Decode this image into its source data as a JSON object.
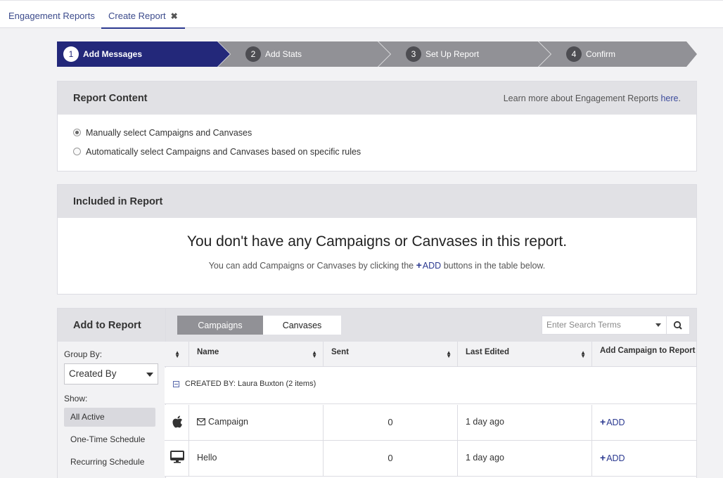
{
  "tabs": [
    {
      "label": "Engagement Reports"
    },
    {
      "label": "Create Report",
      "close": "✖"
    }
  ],
  "wizard": {
    "steps": [
      {
        "num": "1",
        "label": "Add Messages"
      },
      {
        "num": "2",
        "label": "Add Stats"
      },
      {
        "num": "3",
        "label": "Set Up Report"
      },
      {
        "num": "4",
        "label": "Confirm"
      }
    ],
    "active_step": 1
  },
  "report_content": {
    "title": "Report Content",
    "learn_prefix": "Learn more about Engagement Reports",
    "learn_link": "here",
    "learn_suffix": ".",
    "options": [
      {
        "label": "Manually select Campaigns and Canvases",
        "checked": true
      },
      {
        "label": "Automatically select Campaigns and Canvases based on specific rules",
        "checked": false
      }
    ]
  },
  "included": {
    "title": "Included in Report",
    "empty_title": "You don't have any Campaigns or Canvases in this report.",
    "empty_prefix": "You can add Campaigns or Canvases by clicking the",
    "empty_add": "ADD",
    "empty_suffix": "buttons in the table below."
  },
  "add_to_report": {
    "title": "Add to Report",
    "group_by_label": "Group By:",
    "group_by_value": "Created By",
    "show_label": "Show:",
    "show_items": [
      "All Active",
      "One-Time Schedule",
      "Recurring Schedule"
    ],
    "selected_show": "All Active",
    "content_tabs": [
      "Campaigns",
      "Canvases"
    ],
    "active_tab": "Campaigns",
    "search_placeholder": "Enter Search Terms"
  },
  "table": {
    "columns": [
      "",
      "Name",
      "Sent",
      "Last Edited",
      "Add Campaign to Report"
    ],
    "group": "CREATED BY: Laura Buxton (2 items)",
    "rows": [
      {
        "platform_icon": "apple-icon",
        "type_icon": "envelope-icon",
        "name": "Campaign",
        "sent": "0",
        "last_edited": "1 day ago",
        "action": "ADD"
      },
      {
        "platform_icon": "desktop-icon",
        "type_icon": "",
        "name": "Hello",
        "sent": "0",
        "last_edited": "1 day ago",
        "action": "ADD"
      }
    ]
  },
  "colors": {
    "accent": "#2b3990",
    "active_step": "#23287a",
    "inactive_step": "#919196",
    "header_bg": "#e1e1e5"
  }
}
